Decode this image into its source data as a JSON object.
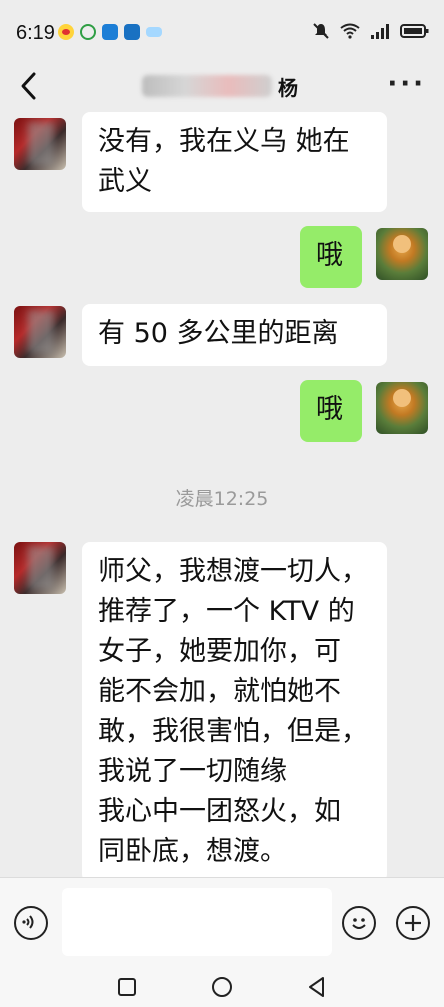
{
  "status_bar": {
    "time": "6:19",
    "icons_left": [
      "weibo-icon",
      "app-icon",
      "app-icon",
      "app-icon",
      "app-icon"
    ],
    "icons_right": [
      "mute-icon",
      "wifi-icon",
      "signal-icon",
      "battery-icon"
    ]
  },
  "header": {
    "contact_name_visible": "杨",
    "back_icon": "chevron-left-icon",
    "more_icon": "more-dots-icon",
    "more_label": "···"
  },
  "messages": [
    {
      "side": "left",
      "text_lines": [
        "没有，我在义乌 她在",
        "武义"
      ]
    },
    {
      "side": "right",
      "text_lines": [
        "哦"
      ]
    },
    {
      "side": "left",
      "text_lines": [
        "有 50 多公里的距离"
      ]
    },
    {
      "side": "right",
      "text_lines": [
        "哦"
      ]
    },
    {
      "type": "timestamp",
      "text": "凌晨12:25"
    },
    {
      "side": "left",
      "text_lines": [
        "师父，我想渡一切人，",
        "推荐了，一个 KTV 的",
        "女子，她要加你，可",
        "能不会加，就怕她不",
        "敢，我很害怕，但是，",
        "我说了一切随缘",
        "我心中一团怒火，如",
        "同卧底，想渡。"
      ]
    }
  ],
  "input_bar": {
    "voice_icon": "voice-icon",
    "emoji_icon": "emoji-icon",
    "plus_icon": "plus-icon",
    "placeholder": ""
  },
  "nav_bar": {
    "icons": [
      "square-recent-icon",
      "circle-home-icon",
      "triangle-back-icon"
    ]
  },
  "colors": {
    "background": "#ededed",
    "bubble_self": "#95ec69",
    "bubble_other": "#ffffff",
    "timestamp_text": "#9a9a9a"
  }
}
